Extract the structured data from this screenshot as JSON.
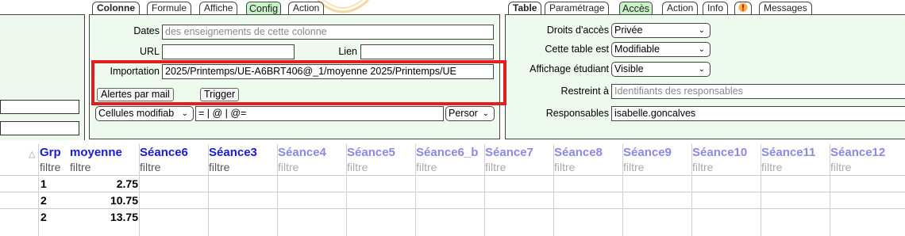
{
  "left_tabs": [
    "Colonne",
    "Formule",
    "Affiche",
    "Config",
    "Action"
  ],
  "right_tabs": [
    "Table",
    "Paramétrage",
    "Accès",
    "Action",
    "Info",
    "Messages"
  ],
  "column_config": {
    "dates_label": "Dates",
    "dates_placeholder": "des enseignements de cette colonne",
    "url_label": "URL",
    "lien_label": "Lien",
    "import_label": "Importation",
    "import_value": "2025/Printemps/UE-A6BRT406@_1/moyenne   2025/Printemps/UE",
    "alerts_button": "Alertes par mail",
    "trigger_button": "Trigger",
    "cells_select": "Cellules modifiab",
    "formula_value": "= | @ | @=",
    "person_select": "Persor"
  },
  "table_access": {
    "rights_label": "Droits d'accès",
    "rights_value": "Privée",
    "state_label": "Cette table est",
    "state_value": "Modifiable",
    "display_label": "Affichage étudiant",
    "display_value": "Visible",
    "restricted_label": "Restreint à",
    "restricted_placeholder": "Identifiants des responsables",
    "managers_label": "Responsables",
    "managers_value": "isabelle.goncalves"
  },
  "grid": {
    "headers": [
      "Grp",
      "moyenne",
      "Séance6",
      "Séance3",
      "Séance4",
      "Séance5",
      "Séance6_b",
      "Séance7",
      "Séance8",
      "Séance9",
      "Séance10",
      "Séance11",
      "Séance12"
    ],
    "filter_label": "filtre",
    "rows": [
      {
        "grp": "1",
        "moyenne": "2.75"
      },
      {
        "grp": "2",
        "moyenne": "10.75"
      },
      {
        "grp": "2",
        "moyenne": "13.75"
      }
    ]
  },
  "colors": {
    "panel_bg": "#eefaee",
    "selected_tab": "#c9f2c9",
    "highlight_box": "#e31e1e",
    "active_header": "#1a1ad6",
    "inactive_header": "#8a8ae6"
  }
}
